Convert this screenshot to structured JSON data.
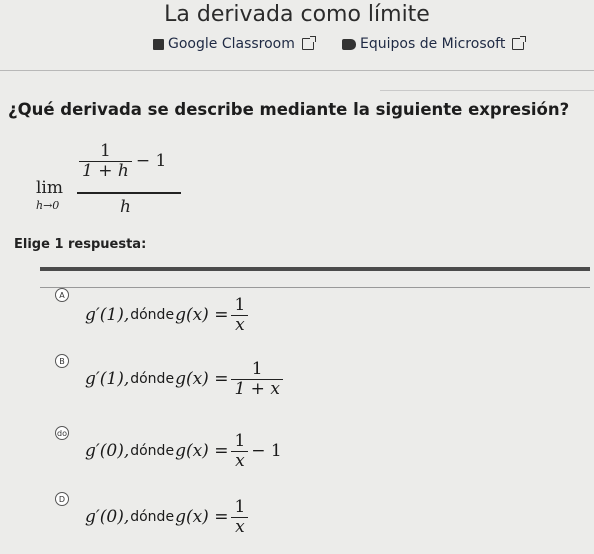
{
  "page": {
    "title": "La derivada como límite"
  },
  "share": {
    "classroom_label": "Google Classroom",
    "teams_label": "Equipos de Microsoft"
  },
  "question": {
    "text": "¿Qué derivada se describe mediante la siguiente expresión?",
    "limit_word": "lim",
    "limit_sub": "h→0",
    "inner_num": "1",
    "inner_den": "1 + h",
    "minus_one": "− 1",
    "outer_den": "h"
  },
  "instructions": "Elige 1 respuesta:",
  "options": [
    {
      "badge": "A",
      "deriv": "g′(1), ",
      "donde": "dónde",
      "fn": "g(x) = ",
      "num": "1",
      "den": "x",
      "tail": ""
    },
    {
      "badge": "B",
      "deriv": "g′(1), ",
      "donde": "dónde",
      "fn": "g(x) = ",
      "num": "1",
      "den": "1 + x",
      "tail": ""
    },
    {
      "badge": "do",
      "deriv": "g′(0), ",
      "donde": "dónde",
      "fn": "g(x) = ",
      "num": "1",
      "den": "x",
      "tail": " − 1"
    },
    {
      "badge": "D",
      "deriv": "g′(0), ",
      "donde": "dónde",
      "fn": "g(x) = ",
      "num": "1",
      "den": "x",
      "tail": ""
    }
  ]
}
